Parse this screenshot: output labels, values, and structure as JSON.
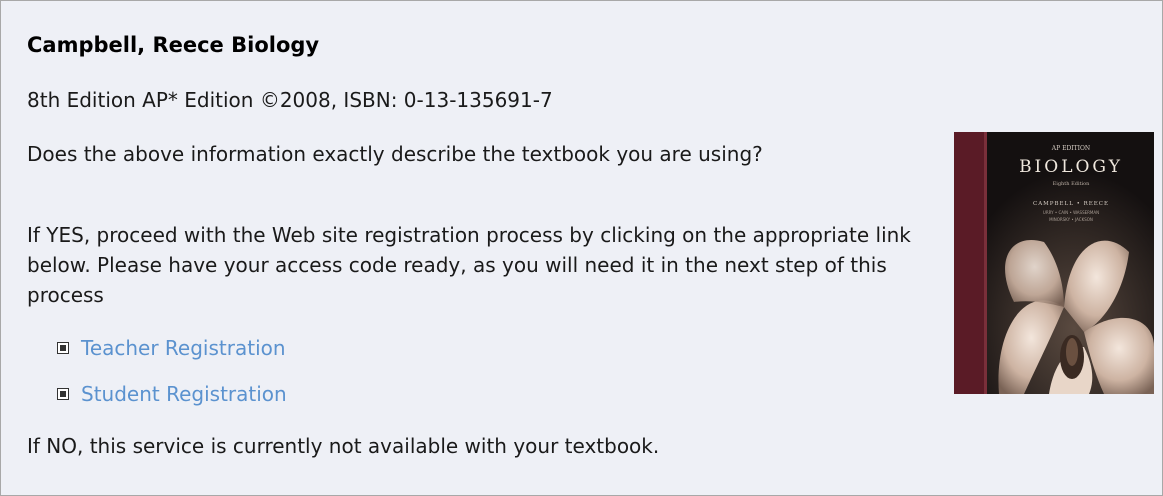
{
  "book": {
    "title": "Campbell, Reece Biology",
    "edition": "8th Edition AP* Edition ©2008, ISBN: 0-13-135691-7"
  },
  "prompt": {
    "question": "Does the above information exactly describe the textbook you are using?",
    "yes_text": "If YES, proceed with the Web site registration process by clicking on the appropriate link below. Please have your access code ready, as you will need it in the next step of this process",
    "no_text": "If NO, this service is currently not available with your textbook."
  },
  "links": [
    {
      "label": "Teacher Registration"
    },
    {
      "label": "Student Registration"
    }
  ],
  "cover": {
    "edition_label": "AP EDITION",
    "title": "BIOLOGY",
    "subtitle": "Eighth Edition",
    "authors": "CAMPBELL • REECE",
    "coauthors_1": "URRY • CAIN • WASSERMAN",
    "coauthors_2": "MINORSKY • JACKSON"
  },
  "colors": {
    "link": "#5b92cf",
    "panel_bg": "#eef0f6",
    "cover_spine": "#5a1b26",
    "cover_bg": "#1a1414"
  }
}
